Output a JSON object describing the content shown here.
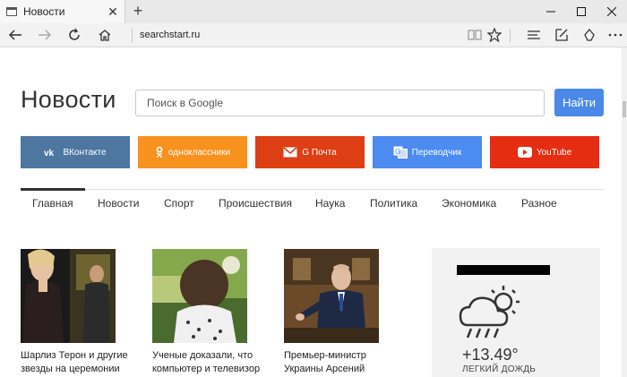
{
  "browser": {
    "tab_title": "Новости",
    "new_tab_symbol": "+",
    "url": "searchstart.ru"
  },
  "page": {
    "title": "Новости"
  },
  "search": {
    "placeholder": "Поиск в Google",
    "button_label": "Найти"
  },
  "quick_links": [
    {
      "label": "ВКонтакте",
      "color": "#4d76a1",
      "icon": "vk-icon"
    },
    {
      "label": "одноклассники",
      "color": "#f7921e",
      "icon": "odnoklassniki-icon"
    },
    {
      "label": "G Почта",
      "color": "#dd3e14",
      "icon": "gmail-icon"
    },
    {
      "label": "Переводчик",
      "color": "#4c8bf0",
      "icon": "translate-icon"
    },
    {
      "label": "YouTube",
      "color": "#e52d12",
      "icon": "youtube-icon"
    }
  ],
  "categories": [
    {
      "label": "Главная",
      "active": true
    },
    {
      "label": "Новости"
    },
    {
      "label": "Спорт"
    },
    {
      "label": "Происшествия"
    },
    {
      "label": "Наука"
    },
    {
      "label": "Политика"
    },
    {
      "label": "Экономика"
    },
    {
      "label": "Разное"
    }
  ],
  "news": [
    {
      "caption": "Шарлиз Терон и другие звезды на церемонии"
    },
    {
      "caption": "Ученые доказали, что компьютер и телевизор"
    },
    {
      "caption": "Премьер-министр Украины Арсений Яценюк"
    }
  ],
  "weather": {
    "temperature": "+13.49°",
    "condition": "ЛЕГКИЙ ДОЖДЬ",
    "icon": "cloud-sun-rain-icon"
  },
  "colors": {
    "accent": "#4a89e8"
  }
}
